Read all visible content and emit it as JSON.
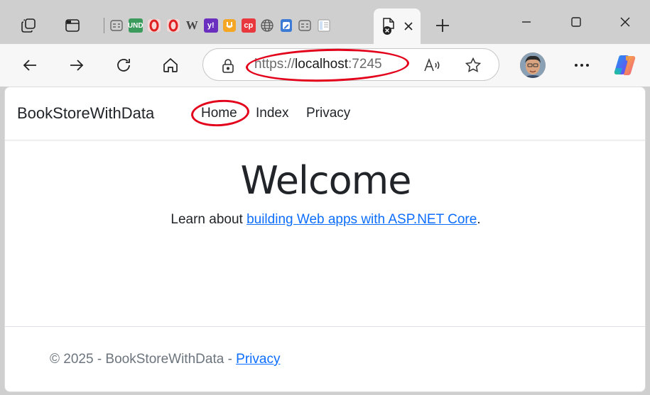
{
  "browser": {
    "tabs": [
      {
        "icon": "generic-page-icon"
      },
      {
        "icon": "und-icon",
        "text": "UND"
      },
      {
        "icon": "opera-icon",
        "text": "O"
      },
      {
        "icon": "opera-icon",
        "text": "O"
      },
      {
        "icon": "wikipedia-icon",
        "text": "W"
      },
      {
        "icon": "yahoo-icon",
        "text": "y!"
      },
      {
        "icon": "outlet-icon",
        "text": ""
      },
      {
        "icon": "cp-icon",
        "text": "cp"
      },
      {
        "icon": "globe-icon",
        "text": ""
      },
      {
        "icon": "doc-edit-icon",
        "text": ""
      },
      {
        "icon": "generic-page-icon",
        "text": ""
      },
      {
        "icon": "reader-icon",
        "text": ""
      }
    ],
    "address_bar": {
      "scheme": "https://",
      "host": "localhost",
      "port": ":7245"
    }
  },
  "site": {
    "brand": "BookStoreWithData",
    "nav": [
      "Home",
      "Index",
      "Privacy"
    ],
    "heading": "Welcome",
    "learn_prefix": "Learn about ",
    "learn_link": "building Web apps with ASP.NET Core",
    "learn_suffix": ".",
    "footer_prefix": "© 2025 - BookStoreWithData - ",
    "footer_link": "Privacy"
  },
  "colors": {
    "annotation_red": "#e3001b",
    "link_blue": "#0d6efd",
    "text_dark": "#212529",
    "footer_gray": "#6c757d"
  }
}
